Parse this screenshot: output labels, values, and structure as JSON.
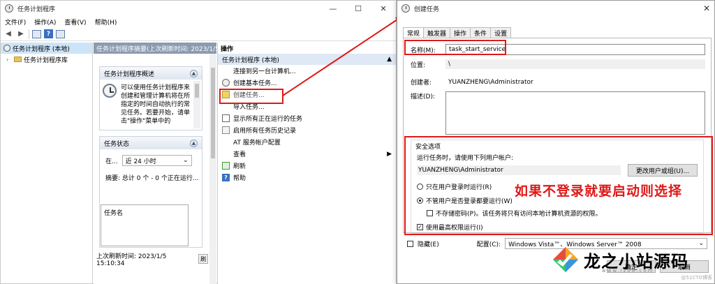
{
  "main": {
    "title": "任务计划程序",
    "win_min": "—",
    "win_max": "☐",
    "win_close": "✕",
    "menu": [
      "文件(F)",
      "操作(A)",
      "查看(V)",
      "帮助(H)"
    ],
    "tree": [
      {
        "label": "任务计划程序 (本地)"
      },
      {
        "label": "任务计划程序库"
      }
    ],
    "mid_header": "任务计划程序摘要(上次刷新时间: 2023/1/5",
    "overview_title": "任务计划程序概述",
    "overview_text": "可以使用任务计划程序来创建和管理计算机将在所指定的时间自动执行的常见任务。若要开始，请单击\"操作\"菜单中的",
    "status_title": "任务状态",
    "status_label": "在...",
    "status_value": "近 24 小时",
    "summary_text": "摘要: 总计 0 个 - 0 个正在运行...",
    "list_header": "任务名",
    "last_refresh": "上次刷新时间: 2023/1/5 15:10:34",
    "refresh_btn": "刷",
    "actions_title": "操作",
    "actions_group": "任务计划程序 (本地)",
    "actions": [
      {
        "label": "连接到另一台计算机...",
        "icon": "blank"
      },
      {
        "label": "创建基本任务...",
        "icon": "clock"
      },
      {
        "label": "创建任务...",
        "icon": "task"
      },
      {
        "label": "导入任务...",
        "icon": "blank"
      },
      {
        "label": "显示所有正在运行的任务",
        "icon": "list"
      },
      {
        "label": "启用所有任务历史记录",
        "icon": "hist"
      },
      {
        "label": "AT 服务帐户配置",
        "icon": "blank"
      },
      {
        "label": "查看",
        "icon": "blank"
      },
      {
        "label": "刷新",
        "icon": "refresh"
      },
      {
        "label": "帮助",
        "icon": "help"
      }
    ]
  },
  "dialog": {
    "title": "创建任务",
    "close": "✕",
    "tabs": [
      "常规",
      "触发器",
      "操作",
      "条件",
      "设置"
    ],
    "name_label": "名称(M):",
    "name_value": "task_start_service",
    "location_label": "位置:",
    "location_value": "\\",
    "author_label": "创建者:",
    "author_value": "YUANZHENG\\Administrator",
    "desc_label": "描述(D):",
    "security_title": "安全选项",
    "run_as_label": "运行任务时，请使用下列用户帐户:",
    "run_as_value": "YUANZHENG\\Administrator",
    "change_user_btn": "更改用户或组(U)...",
    "radio_logged_on": "只在用户登录时运行(R)",
    "radio_any": "不管用户是否登录都要运行(W)",
    "no_store_pwd": "不存储密码(P)。该任务将只有访问本地计算机资源的权限。",
    "highest_priv": "使用最高权限运行(I)",
    "hidden_label": "隐藏(E)",
    "config_label": "配置(C):",
    "config_value": "Windows Vista™、Windows Server™ 2008",
    "ok_btn": "确定",
    "cancel_btn": "取消"
  },
  "annotation": "如果不登录就要启动则选择",
  "watermark": {
    "text": "龙之小站源码",
    "url": "www.lz08.com",
    "corner": "@51CTO博客"
  },
  "colors": {
    "annotation_red": "#e01818",
    "selection_blue": "#cce4f7",
    "group_header": "#dfe9f5"
  }
}
